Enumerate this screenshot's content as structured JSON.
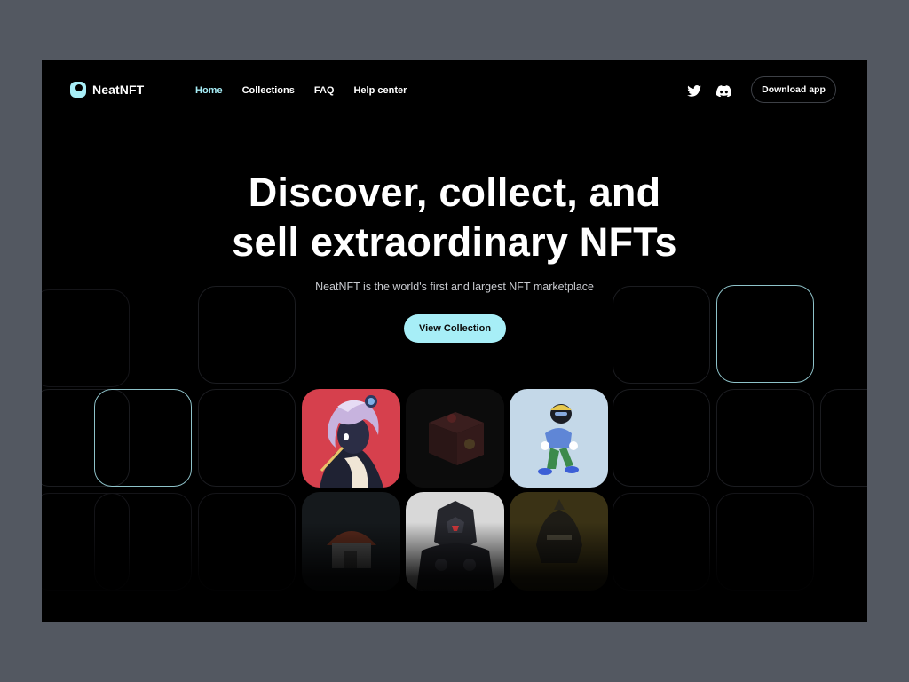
{
  "brand": {
    "name": "NeatNFT"
  },
  "nav": {
    "items": [
      {
        "label": "Home",
        "active": true
      },
      {
        "label": "Collections",
        "active": false
      },
      {
        "label": "FAQ",
        "active": false
      },
      {
        "label": "Help center",
        "active": false
      }
    ]
  },
  "social": {
    "icons": [
      "twitter-icon",
      "discord-icon"
    ]
  },
  "header": {
    "download_label": "Download app"
  },
  "hero": {
    "title_line1": "Discover, collect, and",
    "title_line2": "sell extraordinary NFTs",
    "subtitle": "NeatNFT is the world's first and largest NFT marketplace",
    "cta_label": "View Collection"
  },
  "colors": {
    "accent": "#a7eef7",
    "background": "#000000",
    "page_bg": "#535861"
  },
  "nft_cards": [
    {
      "name": "anime-girl-nft",
      "bg": "#d6404d"
    },
    {
      "name": "treasure-box-nft",
      "bg": "#131313"
    },
    {
      "name": "walking-character-nft",
      "bg": "#c4d8e8"
    },
    {
      "name": "red-dome-house-nft",
      "bg": "#1a1d20"
    },
    {
      "name": "robot-nft",
      "bg": "#e4e4e4"
    },
    {
      "name": "gold-helmet-nft",
      "bg": "#3a3215"
    }
  ]
}
